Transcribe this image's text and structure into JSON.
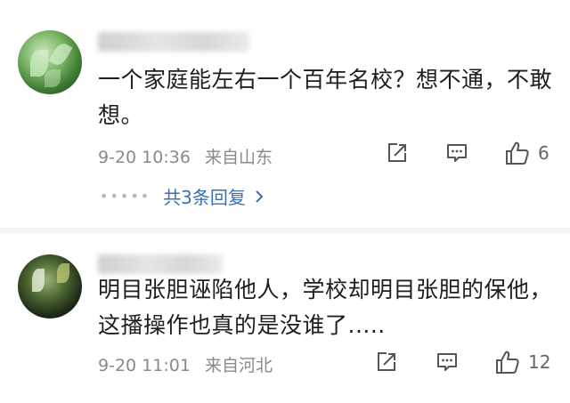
{
  "comments": [
    {
      "username": "",
      "text": "一个家庭能左右一个百年名校？想不通，不敢想。",
      "time": "9-20 10:36",
      "location": "来自山东",
      "likes": "6",
      "replies_label": "共3条回复"
    },
    {
      "username": "",
      "text": "明目张胆诬陷他人，学校却明目张胆的保他，这播操作也真的是没谁了.....",
      "time": "9-20 11:01",
      "location": "来自河北",
      "likes": "12"
    }
  ],
  "icons": {
    "share": "share-icon",
    "reply": "comment-icon",
    "like": "thumbs-up-icon",
    "more": "chevron-right-icon"
  },
  "colors": {
    "link": "#3a6fb0",
    "meta": "#8a8a8a",
    "text": "#1e1e1e"
  }
}
